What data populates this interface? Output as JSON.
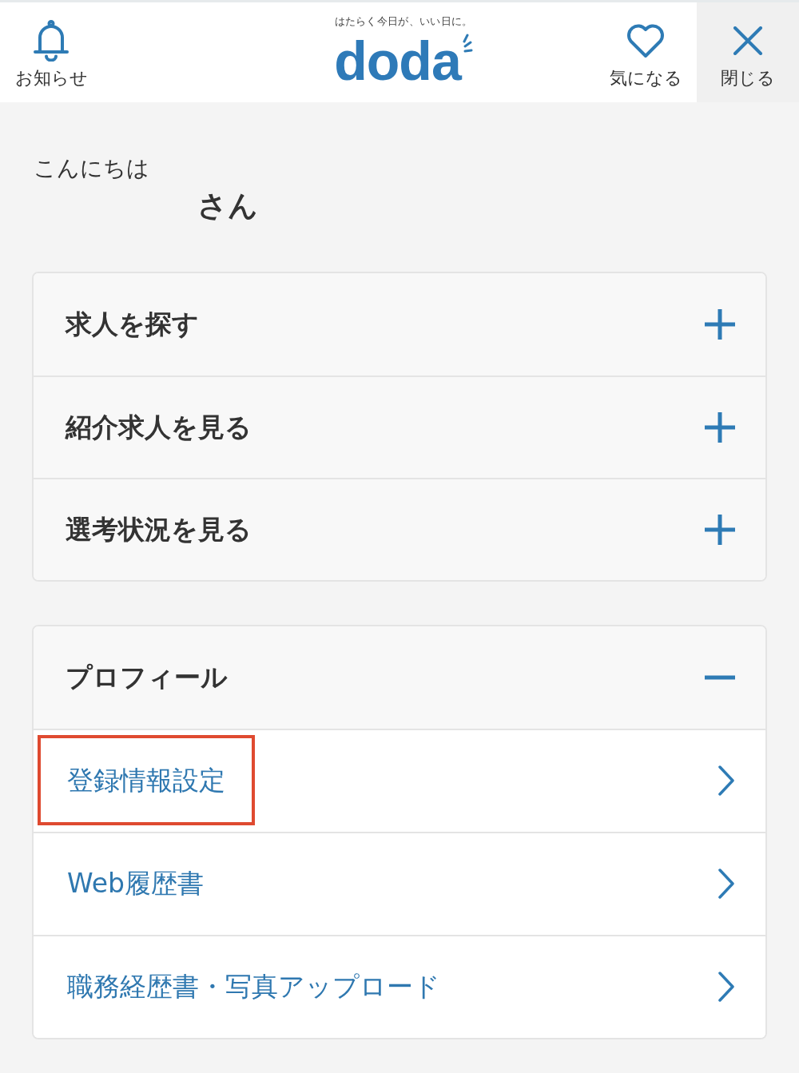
{
  "header": {
    "notice": {
      "label": "お知らせ"
    },
    "logo": {
      "tagline": "はたらく今日が、いい日に。",
      "wordmark": "doda"
    },
    "actions": [
      {
        "kind": "favorite",
        "label": "気になる"
      },
      {
        "kind": "close",
        "label": "閉じる"
      }
    ]
  },
  "greeting": {
    "text": "こんにちは",
    "honorific": "さん"
  },
  "menu_groups": [
    {
      "items": [
        {
          "label": "求人を探す",
          "expanded": false
        },
        {
          "label": "紹介求人を見る",
          "expanded": false
        },
        {
          "label": "選考状況を見る",
          "expanded": false
        }
      ]
    },
    {
      "items": [
        {
          "label": "プロフィール",
          "expanded": true,
          "links": [
            {
              "label": "登録情報設定",
              "highlighted": true
            },
            {
              "label": "Web履歴書",
              "highlighted": false
            },
            {
              "label": "職務経歴書・写真アップロード",
              "highlighted": false
            }
          ]
        }
      ]
    }
  ]
}
